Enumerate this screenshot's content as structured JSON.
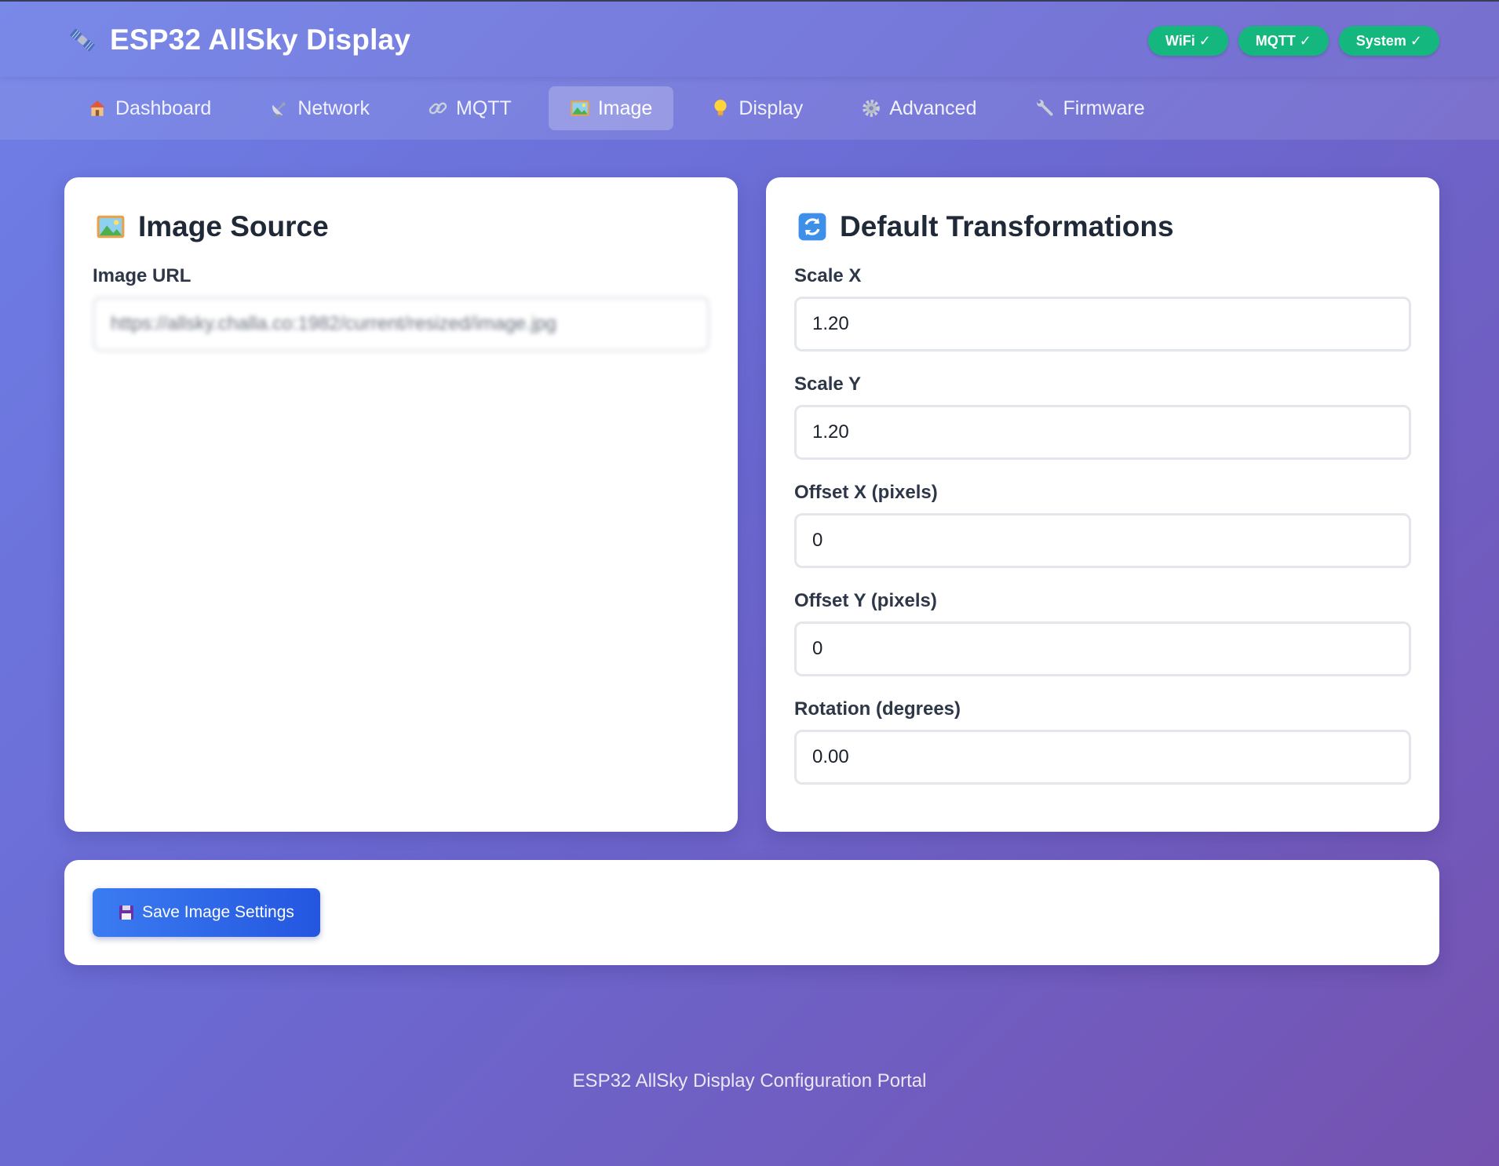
{
  "app": {
    "title": "ESP32 AllSky Display"
  },
  "status_badges": [
    {
      "label": "WiFi ✓",
      "color": "#14b87e"
    },
    {
      "label": "MQTT ✓",
      "color": "#14b87e"
    },
    {
      "label": "System ✓",
      "color": "#14b87e"
    }
  ],
  "nav": {
    "active": "Image",
    "tabs": [
      {
        "label": "Dashboard",
        "icon": "house-icon"
      },
      {
        "label": "Network",
        "icon": "satellite-dish-icon"
      },
      {
        "label": "MQTT",
        "icon": "link-icon"
      },
      {
        "label": "Image",
        "icon": "picture-icon"
      },
      {
        "label": "Display",
        "icon": "lightbulb-icon"
      },
      {
        "label": "Advanced",
        "icon": "gear-icon"
      },
      {
        "label": "Firmware",
        "icon": "wrench-icon"
      }
    ]
  },
  "image_source": {
    "title": "Image Source",
    "icon": "picture-icon",
    "url_label": "Image URL",
    "url_value": "https://allsky.challa.co:1982/current/resized/image.jpg"
  },
  "transformations": {
    "title": "Default Transformations",
    "icon": "refresh-icon",
    "fields": [
      {
        "label": "Scale X",
        "value": "1.20"
      },
      {
        "label": "Scale Y",
        "value": "1.20"
      },
      {
        "label": "Offset X (pixels)",
        "value": "0"
      },
      {
        "label": "Offset Y (pixels)",
        "value": "0"
      },
      {
        "label": "Rotation (degrees)",
        "value": "0.00"
      }
    ]
  },
  "actions": {
    "save_label": "Save Image Settings",
    "save_icon": "floppy-disk-icon"
  },
  "footer": {
    "text": "ESP32 AllSky Display Configuration Portal"
  },
  "colors": {
    "background_start": "#6e7fe6",
    "background_end": "#7552b0",
    "badge_green": "#14b87e",
    "primary_button": "#2f6ae9"
  }
}
